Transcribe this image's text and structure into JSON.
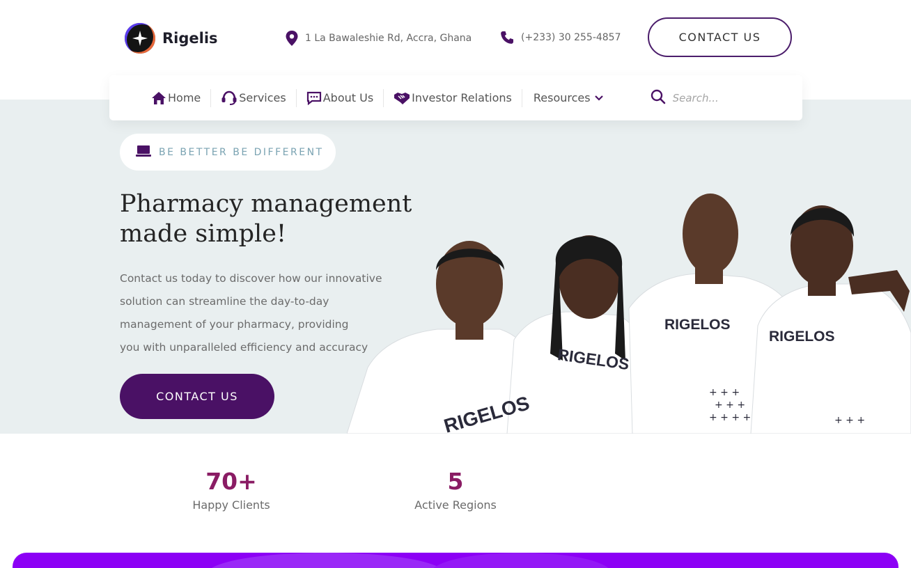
{
  "brand": {
    "name": "Rigelis",
    "logo_icon": "star-badge-icon"
  },
  "header": {
    "address": "1 La Bawaleshie Rd, Accra, Ghana",
    "phone": "(+233) 30 255-4857",
    "contact_button": "CONTACT US"
  },
  "nav": {
    "items": [
      {
        "label": "Home",
        "icon": "home-icon"
      },
      {
        "label": "Services",
        "icon": "headset-icon"
      },
      {
        "label": "About Us",
        "icon": "chat-icon"
      },
      {
        "label": "Investor Relations",
        "icon": "handshake-icon"
      },
      {
        "label": "Resources",
        "icon": "chevron-down-icon"
      }
    ],
    "search_placeholder": "Search..."
  },
  "hero": {
    "tagline": "BE BETTER BE DIFFERENT",
    "title_line1": "Pharmacy management",
    "title_line2": "made simple!",
    "desc_line1": "Contact us today to discover how our innovative",
    "desc_line2": "solution can streamline the day-to-day",
    "desc_line3": "management of your pharmacy, providing",
    "desc_line4": "you with unparalleled efficiency and accuracy",
    "cta": "CONTACT US",
    "shirt_text": "RIGELOS"
  },
  "stats": [
    {
      "value": "70+",
      "label": "Happy Clients"
    },
    {
      "value": "5",
      "label": "Active Regions"
    }
  ],
  "colors": {
    "primary": "#4a1165",
    "accent": "#8a1c64",
    "hero_bg": "#e9eff0",
    "banner": "#8c00f5"
  }
}
